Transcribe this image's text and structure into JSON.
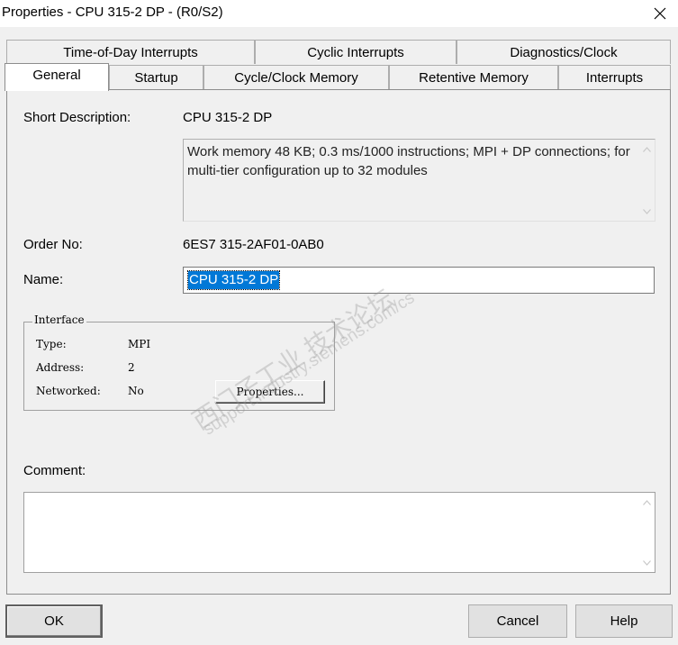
{
  "window": {
    "title": "Properties - CPU 315-2 DP - (R0/S2)"
  },
  "tabs": {
    "row1": [
      "Time-of-Day Interrupts",
      "Cyclic Interrupts",
      "Diagnostics/Clock"
    ],
    "row2": [
      "General",
      "Startup",
      "Cycle/Clock Memory",
      "Retentive Memory",
      "Interrupts"
    ],
    "active": "General"
  },
  "general": {
    "short_description_label": "Short Description:",
    "short_description_value": "CPU 315-2 DP",
    "description_text": "Work memory 48 KB; 0.3 ms/1000 instructions; MPI + DP connections; for multi-tier configuration up to 32 modules",
    "order_no_label": "Order No:",
    "order_no_value": "6ES7 315-2AF01-0AB0",
    "name_label": "Name:",
    "name_value": "CPU 315-2 DP",
    "comment_label": "Comment:",
    "comment_value": ""
  },
  "interface": {
    "title": "Interface",
    "type_label": "Type:",
    "type_value": "MPI",
    "address_label": "Address:",
    "address_value": "2",
    "networked_label": "Networked:",
    "networked_value": "No",
    "properties_button": "Properties..."
  },
  "buttons": {
    "ok": "OK",
    "cancel": "Cancel",
    "help": "Help"
  },
  "watermark": {
    "chinese": "西门子工业  技术论坛",
    "url": "support.industry.siemens.com/cs"
  }
}
